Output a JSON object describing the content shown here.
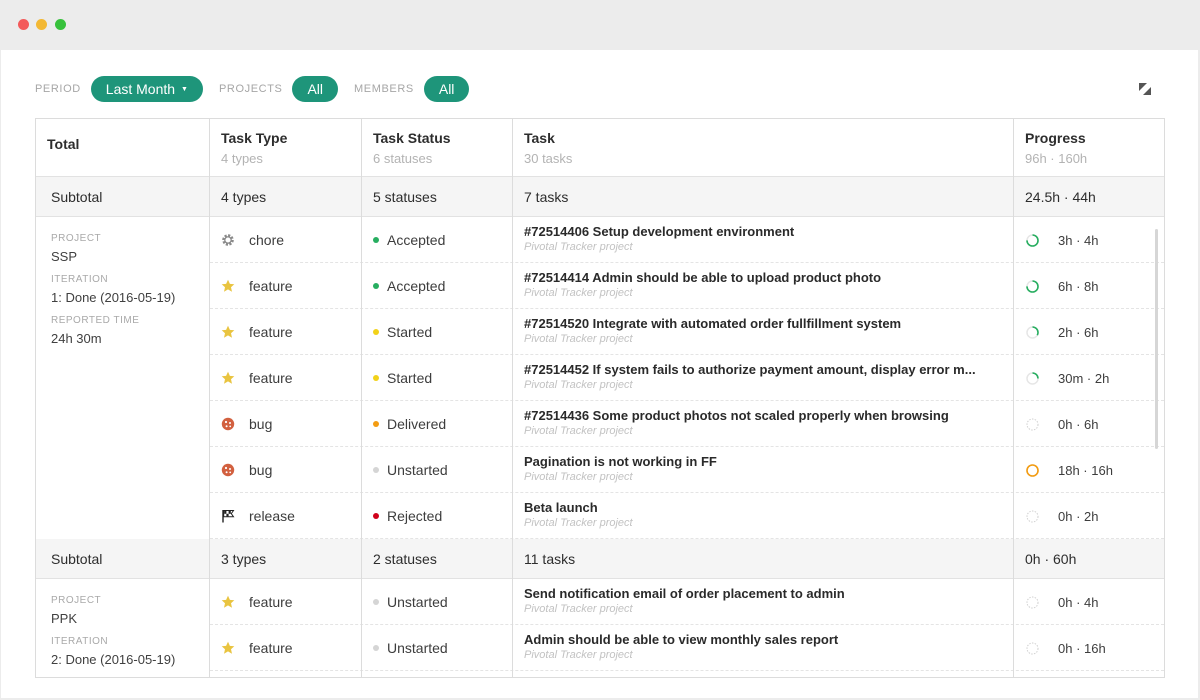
{
  "filters": {
    "period_label": "PERIOD",
    "period_value": "Last Month",
    "projects_label": "PROJECTS",
    "projects_value": "All",
    "members_label": "MEMBERS",
    "members_value": "All"
  },
  "header": {
    "total": "Total",
    "task_type": "Task Type",
    "task_type_sub": "4 types",
    "task_status": "Task Status",
    "task_status_sub": "6 statuses",
    "task": "Task",
    "task_sub": "30 tasks",
    "progress": "Progress",
    "progress_sub": "96h · 160h"
  },
  "labels": {
    "project": "PROJECT",
    "iteration": "ITERATION",
    "reported_time": "REPORTED TIME",
    "subtotal": "Subtotal"
  },
  "groups": [
    {
      "subtotal": {
        "types": "4 types",
        "statuses": "5 statuses",
        "tasks": "7 tasks",
        "progress": "24.5h · 44h"
      },
      "project": "SSP",
      "iteration": "1: Done (2016-05-19)",
      "reported_time": "24h 30m",
      "rows": [
        {
          "type": "chore",
          "type_icon": "gear-icon",
          "status": "Accepted",
          "status_color": "#27ae60",
          "task": "#72514406 Setup development environment",
          "task_sub": "Pivotal Tracker project",
          "progress": "3h · 4h",
          "progress_fraction": 0.75,
          "progress_color": "#27ae60"
        },
        {
          "type": "feature",
          "type_icon": "star-icon",
          "status": "Accepted",
          "status_color": "#27ae60",
          "task": "#72514414 Admin should be able to upload product photo",
          "task_sub": "Pivotal Tracker project",
          "progress": "6h · 8h",
          "progress_fraction": 0.75,
          "progress_color": "#27ae60"
        },
        {
          "type": "feature",
          "type_icon": "star-icon",
          "status": "Started",
          "status_color": "#f2d219",
          "task": "#72514520 Integrate with automated order fullfillment system",
          "task_sub": "Pivotal Tracker project",
          "progress": "2h · 6h",
          "progress_fraction": 0.33,
          "progress_color": "#27ae60"
        },
        {
          "type": "feature",
          "type_icon": "star-icon",
          "status": "Started",
          "status_color": "#f2d219",
          "task": "#72514452 If system fails to authorize payment amount, display error m...",
          "task_sub": "Pivotal Tracker project",
          "progress": "30m · 2h",
          "progress_fraction": 0.25,
          "progress_color": "#27ae60"
        },
        {
          "type": "bug",
          "type_icon": "bug-icon",
          "status": "Delivered",
          "status_color": "#f39c12",
          "task": "#72514436 Some product photos not scaled properly when browsing",
          "task_sub": "Pivotal Tracker project",
          "progress": "0h · 6h",
          "progress_fraction": 0,
          "progress_color": "#27ae60"
        },
        {
          "type": "bug",
          "type_icon": "bug-icon",
          "status": "Unstarted",
          "status_color": "#d5d5d5",
          "task": "Pagination is not working in FF",
          "task_sub": "Pivotal Tracker project",
          "progress": "18h · 16h",
          "progress_fraction": 1,
          "progress_color": "#f39c12"
        },
        {
          "type": "release",
          "type_icon": "flag-icon",
          "status": "Rejected",
          "status_color": "#d0021b",
          "task": "Beta launch",
          "task_sub": "Pivotal Tracker project",
          "progress": "0h · 2h",
          "progress_fraction": 0,
          "progress_color": "#27ae60"
        }
      ]
    },
    {
      "subtotal": {
        "types": "3 types",
        "statuses": "2 statuses",
        "tasks": "11 tasks",
        "progress": "0h · 60h"
      },
      "project": "PPK",
      "iteration": "2: Done (2016-05-19)",
      "reported_time": "",
      "rows": [
        {
          "type": "feature",
          "type_icon": "star-icon",
          "status": "Unstarted",
          "status_color": "#d5d5d5",
          "task": "Send notification email of order placement to admin",
          "task_sub": "Pivotal Tracker project",
          "progress": "0h · 4h",
          "progress_fraction": 0,
          "progress_color": "#27ae60"
        },
        {
          "type": "feature",
          "type_icon": "star-icon",
          "status": "Unstarted",
          "status_color": "#d5d5d5",
          "task": "Admin should be able to view monthly sales report",
          "task_sub": "Pivotal Tracker project",
          "progress": "0h · 16h",
          "progress_fraction": 0,
          "progress_color": "#27ae60"
        }
      ]
    }
  ]
}
